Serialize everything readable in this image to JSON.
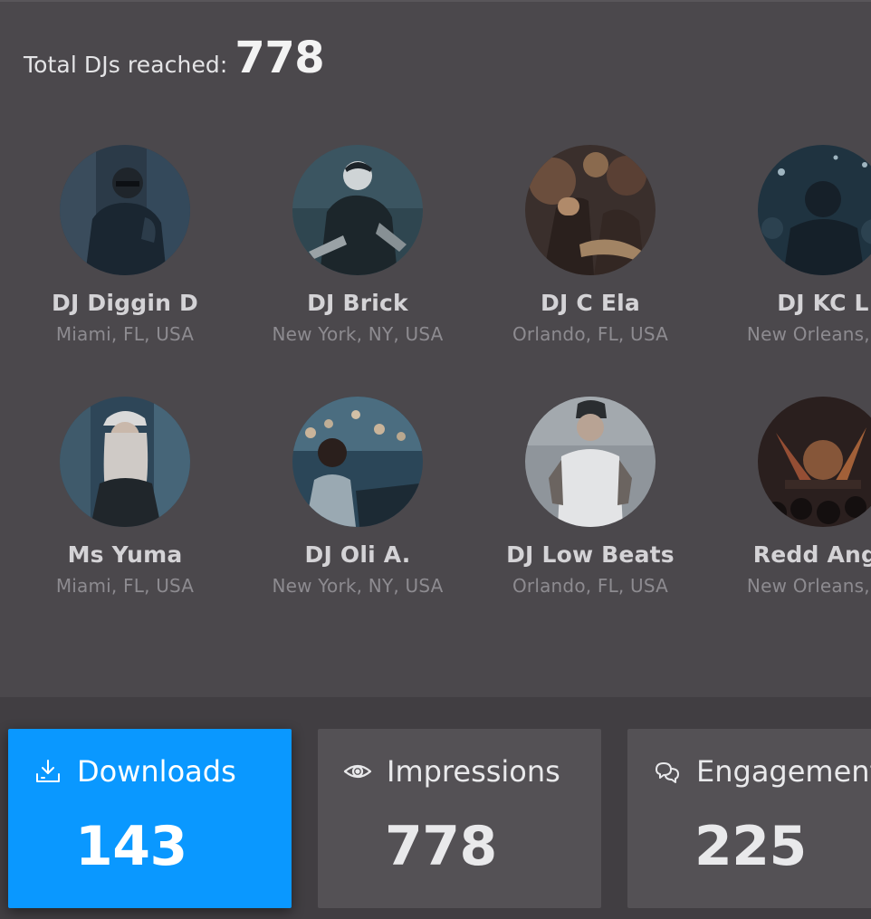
{
  "summary": {
    "total_label": "Total DJs reached:",
    "total_value": "778"
  },
  "djs": [
    {
      "name": "DJ Diggin D",
      "location": "Miami, FL, USA",
      "avatar": "dj-photo"
    },
    {
      "name": "DJ Brick",
      "location": "New York, NY, USA",
      "avatar": "dj-photo"
    },
    {
      "name": "DJ C Ela",
      "location": "Orlando, FL, USA",
      "avatar": "crowd-photo"
    },
    {
      "name": "DJ KC L",
      "location": "New Orleans, LA",
      "avatar": "crowd-photo"
    },
    {
      "name": "Ms Yuma",
      "location": "Miami, FL, USA",
      "avatar": "dj-photo"
    },
    {
      "name": "DJ Oli A.",
      "location": "New York, NY, USA",
      "avatar": "crowd-photo"
    },
    {
      "name": "DJ Low Beats",
      "location": "Orlando, FL, USA",
      "avatar": "dj-photo"
    },
    {
      "name": "Redd Ange",
      "location": "New Orleans, LA",
      "avatar": "concert-photo"
    }
  ],
  "stats": {
    "downloads": {
      "label": "Downloads",
      "value": "143",
      "icon": "download-icon",
      "color": "#0a98ff"
    },
    "impressions": {
      "label": "Impressions",
      "value": "778",
      "icon": "eye-icon"
    },
    "engagement": {
      "label": "Engagement",
      "value": "225",
      "icon": "chat-bubbles-icon"
    }
  },
  "colors": {
    "background": "#4b484c",
    "accent": "#0a98ff",
    "card": "#545155"
  }
}
